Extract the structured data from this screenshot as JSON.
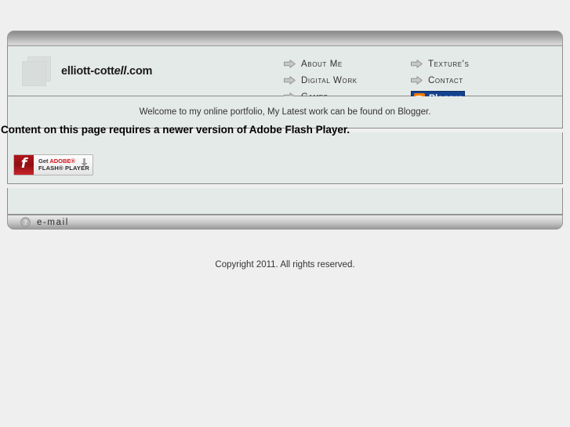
{
  "site": {
    "brand": {
      "logo_icon": "stacked-pages-icon",
      "name_part1": "elliott-cott",
      "name_part2": "ell",
      "name_part3": ".com"
    },
    "nav": {
      "arrow_icon": "arrow-right-icon",
      "column1": [
        {
          "label": "About Me"
        },
        {
          "label": "Digital Work"
        },
        {
          "label": "Games"
        }
      ],
      "column2": [
        {
          "label": "Texture's"
        },
        {
          "label": "Contact"
        }
      ],
      "blogger": {
        "badge_letter": "B",
        "label": "Blogger",
        "bg_color": "#14428f",
        "icon_color": "#f57d00"
      }
    },
    "welcome": {
      "text": "Welcome to my online portfolio, My Latest work can be found on Blogger."
    },
    "flash": {
      "message": "Content on this page requires a newer version of Adobe Flash Player.",
      "button": {
        "logo_glyph": "f",
        "line1_prefix": "Get ",
        "line1_brand": "ADOBE®",
        "line2": "FLASH® PLAYER",
        "download_icon": "download-arrow-icon",
        "brand_color": "#d4131a"
      }
    },
    "footer": {
      "email_icon": "question-circle-icon",
      "email_label": "e-mail"
    },
    "copyright": "Copyright 2011. All rights reserved."
  },
  "colors": {
    "page_background": "#efefef",
    "panel_background": "#e4eae8",
    "panel_border": "#8d8d8d",
    "bar_gradient_dark": "#8b8b8b",
    "bar_gradient_light": "#d7d7d7"
  }
}
